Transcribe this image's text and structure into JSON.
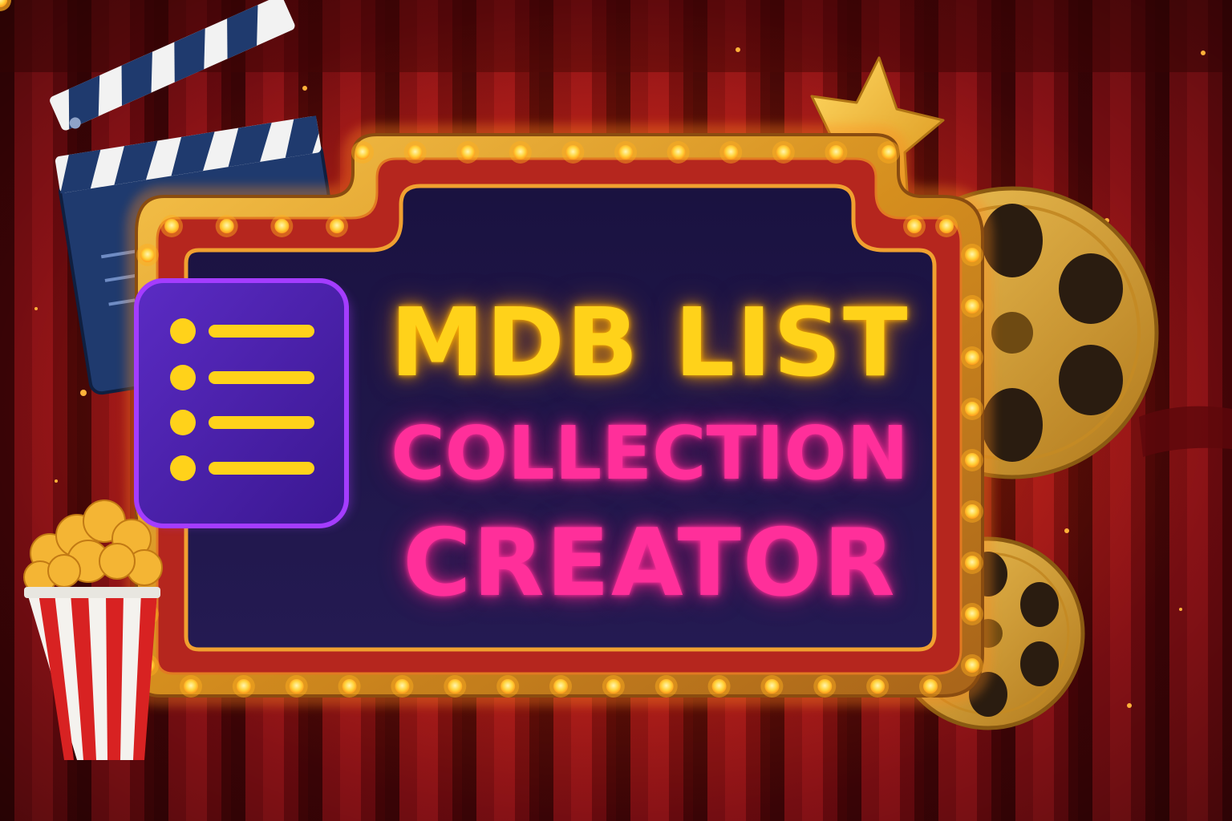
{
  "sign": {
    "line1": "MDB LIST",
    "line2": "COLLECTION",
    "line3": "CREATOR"
  },
  "colors": {
    "curtain": "#8e0c12",
    "marquee_frame": "#e8961e",
    "marquee_panel": "#1c1445",
    "bulb": "#ffd23a",
    "title_yellow": "#ffd21a",
    "title_pink": "#ff2f9a",
    "list_icon_bg": "#4b1fa8",
    "list_icon_border": "#a43cff"
  },
  "icons": [
    "clapperboard-icon",
    "star-icon",
    "film-reel-icon",
    "popcorn-icon",
    "list-icon"
  ]
}
